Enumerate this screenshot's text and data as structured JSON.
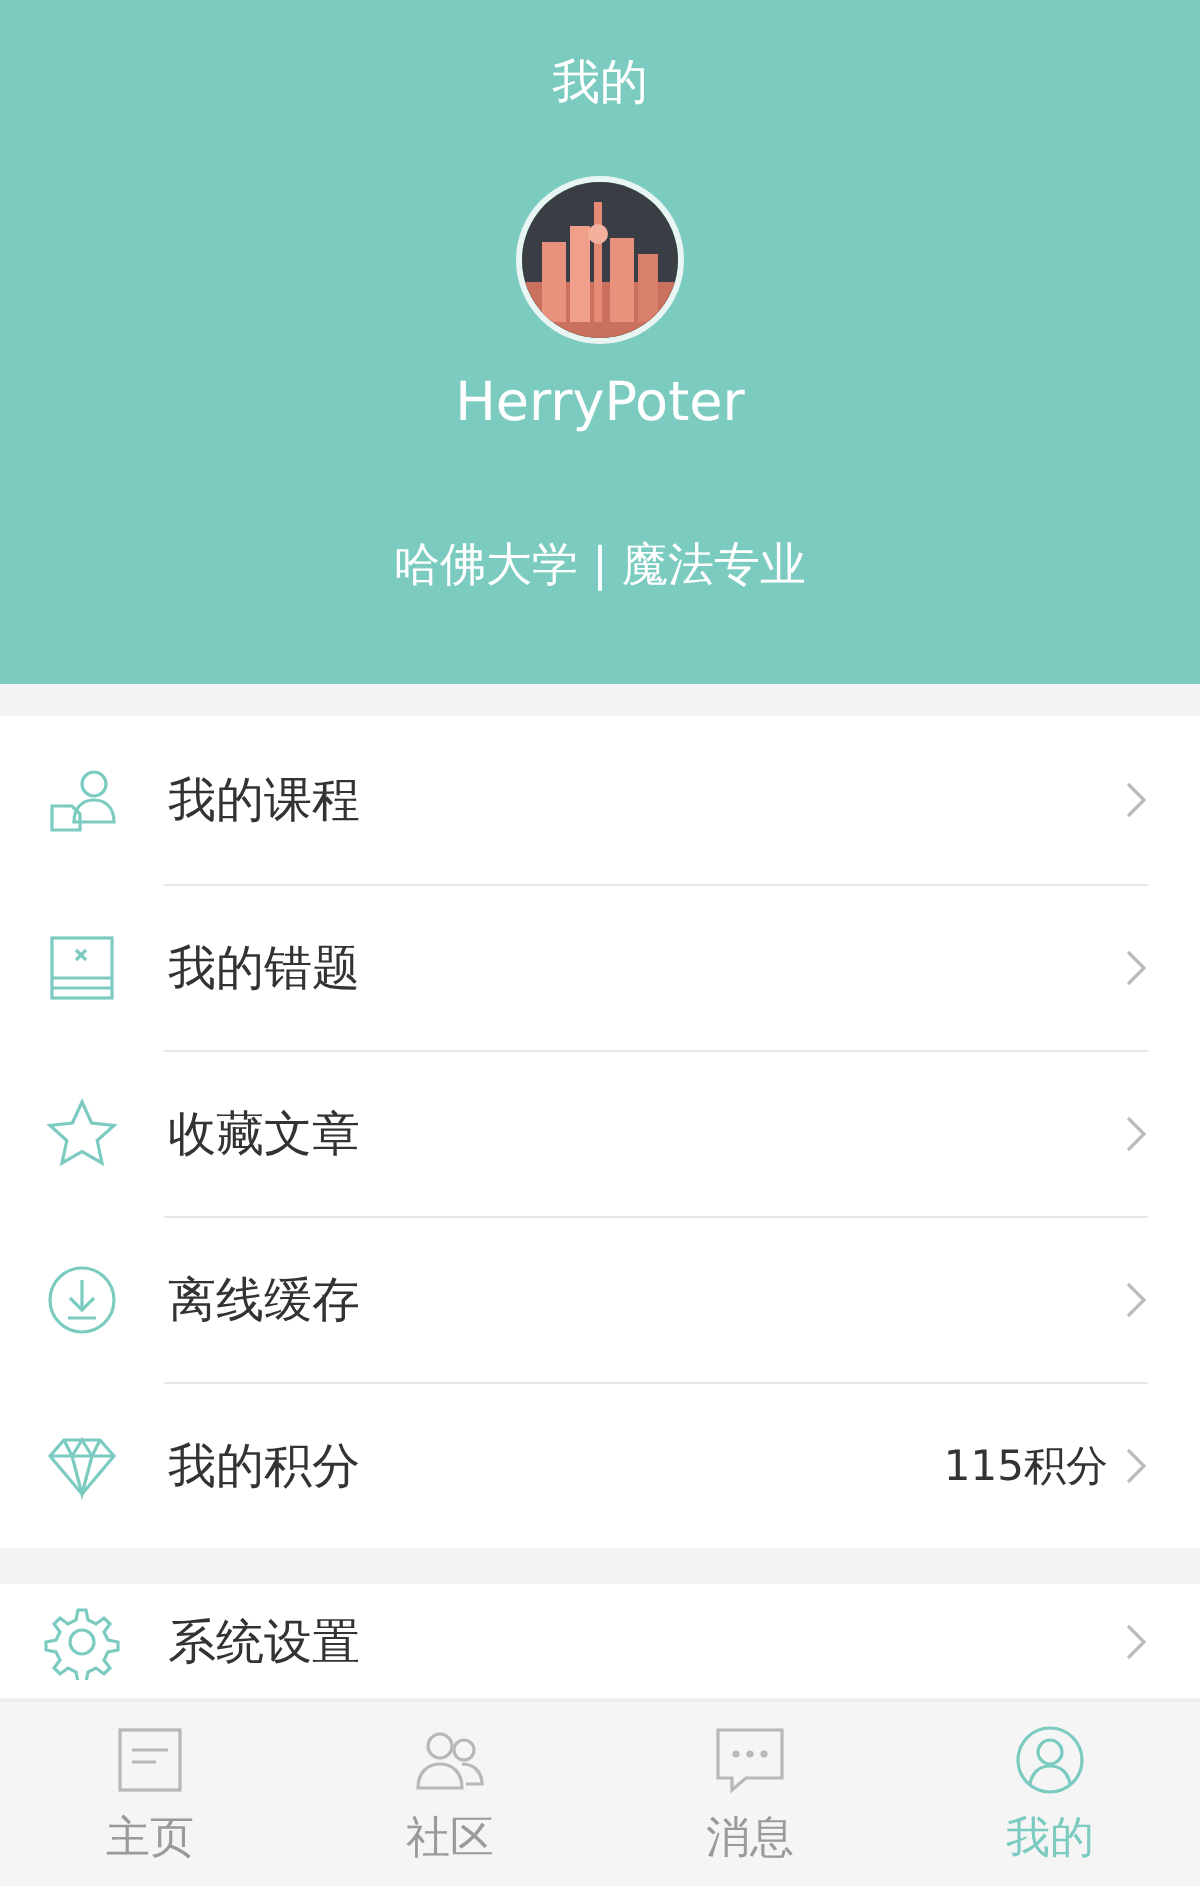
{
  "header": {
    "title": "我的",
    "username": "HerryPoter",
    "school": "哈佛大学 | 魔法专业"
  },
  "menu_groups": [
    {
      "items": [
        {
          "label": "我的课程"
        },
        {
          "label": "我的错题"
        },
        {
          "label": "收藏文章"
        },
        {
          "label": "离线缓存"
        },
        {
          "label": "我的积分",
          "value": "115积分"
        }
      ]
    },
    {
      "items": [
        {
          "label": "系统设置"
        }
      ]
    }
  ],
  "tab_bar": [
    {
      "label": "主页",
      "selected": false
    },
    {
      "label": "社区",
      "selected": false
    },
    {
      "label": "消息",
      "selected": false
    },
    {
      "label": "我的",
      "selected": true
    }
  ]
}
